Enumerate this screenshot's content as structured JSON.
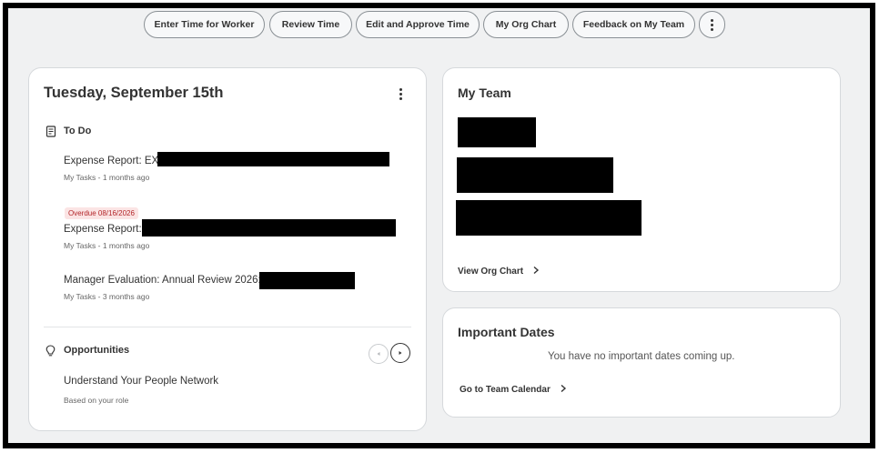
{
  "toolbar": {
    "buttons": [
      {
        "label": "Enter Time for Worker"
      },
      {
        "label": "Review Time"
      },
      {
        "label": "Edit and Approve Time"
      },
      {
        "label": "My Org Chart"
      },
      {
        "label": "Feedback on My Team"
      }
    ],
    "more_icon": "more-vertical-icon"
  },
  "todo_card": {
    "date_title": "Tuesday, September 15th",
    "section_label": "To Do",
    "section_icon": "clipboard-list-icon",
    "tasks": [
      {
        "title": "Expense Report: EX-",
        "meta": "My Tasks - 1 months ago",
        "badge": ""
      },
      {
        "title": "Expense Report:",
        "meta": "My Tasks - 1 months ago",
        "badge": "Overdue 08/16/2026"
      },
      {
        "title": "Manager Evaluation: Annual Review 2026:",
        "meta": "My Tasks - 3 months ago",
        "badge": ""
      }
    ],
    "opportunities": {
      "label": "Opportunities",
      "icon": "lightbulb-icon",
      "item_title": "Understand Your People Network",
      "item_meta": "Based on your role"
    }
  },
  "my_team_card": {
    "title": "My Team",
    "link_label": "View Org Chart"
  },
  "important_dates_card": {
    "title": "Important Dates",
    "empty_message": "You have no important dates coming up.",
    "link_label": "Go to Team Calendar"
  },
  "colors": {
    "page_bg": "#f0f1f2",
    "overdue_badge_bg": "#fbe4e4",
    "overdue_badge_text": "#b3262a"
  }
}
